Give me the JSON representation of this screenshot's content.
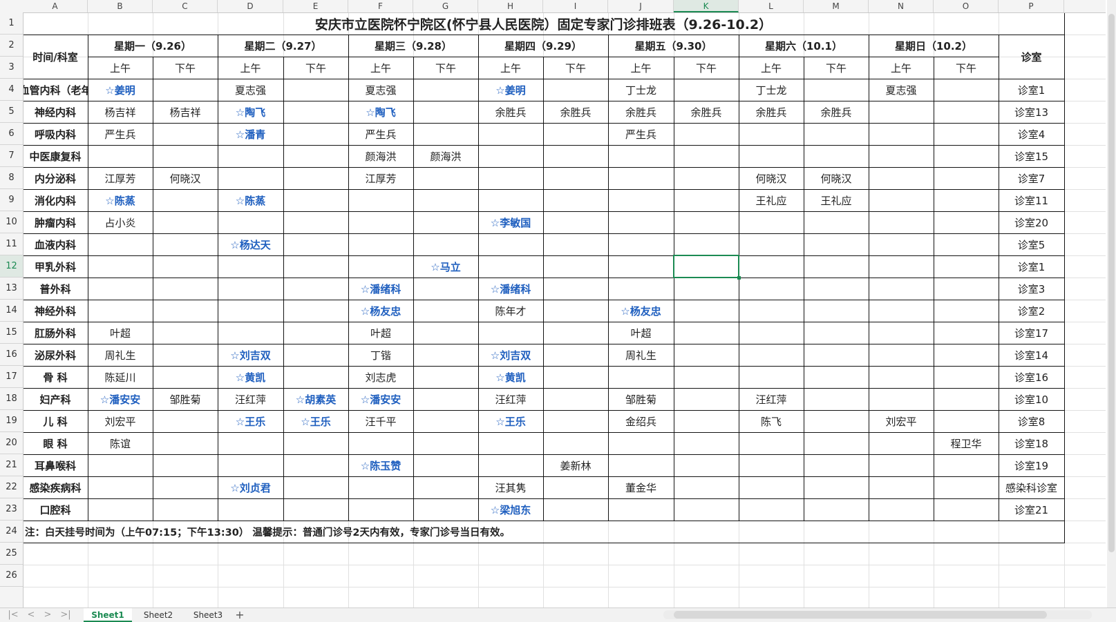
{
  "columns": [
    "A",
    "B",
    "C",
    "D",
    "E",
    "F",
    "G",
    "H",
    "I",
    "J",
    "K",
    "L",
    "M",
    "N",
    "O",
    "P"
  ],
  "selected_column": "K",
  "selected_row": 12,
  "rows": [
    1,
    2,
    3,
    4,
    5,
    6,
    7,
    8,
    9,
    10,
    11,
    12,
    13,
    14,
    15,
    16,
    17,
    18,
    19,
    20,
    21,
    22,
    23,
    24,
    25,
    26
  ],
  "title": "安庆市立医院怀宁院区(怀宁县人民医院）固定专家门诊排班表（9.26-10.2）",
  "header": {
    "time_dept": "时间/科室",
    "days": [
      "星期一（9.26）",
      "星期二（9.27）",
      "星期三（9.28）",
      "星期四（9.29）",
      "星期五（9.30）",
      "星期六（10.1）",
      "星期日（10.2）"
    ],
    "am": "上午",
    "pm": "下午",
    "room": "诊室"
  },
  "schedule": [
    {
      "dept": "心血管内科（老年病",
      "cells": [
        "☆姜明",
        "",
        "夏志强",
        "",
        "夏志强",
        "",
        "☆姜明",
        "",
        "丁士龙",
        "",
        "丁士龙",
        "",
        "夏志强",
        ""
      ],
      "room": "诊室1"
    },
    {
      "dept": "神经内科",
      "cells": [
        "杨吉祥",
        "杨吉祥",
        "☆陶飞",
        "",
        "☆陶飞",
        "",
        "余胜兵",
        "余胜兵",
        "余胜兵",
        "余胜兵",
        "余胜兵",
        "余胜兵",
        "",
        ""
      ],
      "room": "诊室13"
    },
    {
      "dept": "呼吸内科",
      "cells": [
        "严生兵",
        "",
        "☆潘青",
        "",
        "严生兵",
        "",
        "",
        "",
        "严生兵",
        "",
        "",
        "",
        "",
        ""
      ],
      "room": "诊室4"
    },
    {
      "dept": "中医康复科",
      "cells": [
        "",
        "",
        "",
        "",
        "颜海洪",
        "颜海洪",
        "",
        "",
        "",
        "",
        "",
        "",
        "",
        ""
      ],
      "room": "诊室15"
    },
    {
      "dept": "内分泌科",
      "cells": [
        "江厚芳",
        "何晓汉",
        "",
        "",
        "江厚芳",
        "",
        "",
        "",
        "",
        "",
        "何晓汉",
        "何晓汉",
        "",
        ""
      ],
      "room": "诊室7"
    },
    {
      "dept": "消化内科",
      "cells": [
        "☆陈蒸",
        "",
        "☆陈蒸",
        "",
        "",
        "",
        "",
        "",
        "",
        "",
        "王礼应",
        "王礼应",
        "",
        ""
      ],
      "room": "诊室11"
    },
    {
      "dept": "肿瘤内科",
      "cells": [
        "占小炎",
        "",
        "",
        "",
        "",
        "",
        "☆李敏国",
        "",
        "",
        "",
        "",
        "",
        "",
        ""
      ],
      "room": "诊室20"
    },
    {
      "dept": "血液内科",
      "cells": [
        "",
        "",
        "☆杨达天",
        "",
        "",
        "",
        "",
        "",
        "",
        "",
        "",
        "",
        "",
        ""
      ],
      "room": "诊室5"
    },
    {
      "dept": "甲乳外科",
      "cells": [
        "",
        "",
        "",
        "",
        "",
        "☆马立",
        "",
        "",
        "",
        "",
        "",
        "",
        "",
        ""
      ],
      "room": "诊室1"
    },
    {
      "dept": "普外科",
      "cells": [
        "",
        "",
        "",
        "",
        "☆潘绪科",
        "",
        "☆潘绪科",
        "",
        "",
        "",
        "",
        "",
        "",
        ""
      ],
      "room": "诊室3"
    },
    {
      "dept": "神经外科",
      "cells": [
        "",
        "",
        "",
        "",
        "☆杨友忠",
        "",
        "陈年才",
        "",
        "☆杨友忠",
        "",
        "",
        "",
        "",
        ""
      ],
      "room": "诊室2"
    },
    {
      "dept": "肛肠外科",
      "cells": [
        "叶超",
        "",
        "",
        "",
        "叶超",
        "",
        "",
        "",
        "叶超",
        "",
        "",
        "",
        "",
        ""
      ],
      "room": "诊室17"
    },
    {
      "dept": "泌尿外科",
      "cells": [
        "周礼生",
        "",
        "☆刘吉双",
        "",
        "丁锴",
        "",
        "☆刘吉双",
        "",
        "周礼生",
        "",
        "",
        "",
        "",
        ""
      ],
      "room": "诊室14"
    },
    {
      "dept": "骨  科",
      "cells": [
        "陈延川",
        "",
        "☆黄凯",
        "",
        "刘志虎",
        "",
        "☆黄凯",
        "",
        "",
        "",
        "",
        "",
        "",
        ""
      ],
      "room": "诊室16"
    },
    {
      "dept": "妇产科",
      "cells": [
        "☆潘安安",
        "邹胜菊",
        "汪红萍",
        "☆胡素英",
        "☆潘安安",
        "",
        "汪红萍",
        "",
        "邹胜菊",
        "",
        "汪红萍",
        "",
        "",
        ""
      ],
      "room": "诊室10"
    },
    {
      "dept": "儿  科",
      "cells": [
        "刘宏平",
        "",
        "☆王乐",
        "☆王乐",
        "汪千平",
        "",
        "☆王乐",
        "",
        "金绍兵",
        "",
        "陈飞",
        "",
        "刘宏平",
        ""
      ],
      "room": "诊室8"
    },
    {
      "dept": "眼  科",
      "cells": [
        "陈谊",
        "",
        "",
        "",
        "",
        "",
        "",
        "",
        "",
        "",
        "",
        "",
        "",
        "程卫华"
      ],
      "room": "诊室18"
    },
    {
      "dept": "耳鼻喉科",
      "cells": [
        "",
        "",
        "",
        "",
        "☆陈玉赞",
        "",
        "",
        "姜新林",
        "",
        "",
        "",
        "",
        "",
        ""
      ],
      "room": "诊室19"
    },
    {
      "dept": "感染疾病科",
      "cells": [
        "",
        "",
        "☆刘贞君",
        "",
        "",
        "",
        "汪其隽",
        "",
        "董金华",
        "",
        "",
        "",
        "",
        ""
      ],
      "room": "感染科诊室"
    },
    {
      "dept": "口腔科",
      "cells": [
        "",
        "",
        "",
        "",
        "",
        "",
        "☆梁旭东",
        "",
        "",
        "",
        "",
        "",
        "",
        ""
      ],
      "room": "诊室21"
    }
  ],
  "note": "注：白天挂号时间为（上午07:15；下午13:30）   温馨提示：普通门诊号2天内有效，专家门诊号当日有效。",
  "sheets": [
    "Sheet1",
    "Sheet2",
    "Sheet3"
  ],
  "active_sheet": "Sheet1",
  "nav_icons": [
    "first-sheet-icon",
    "prev-sheet-icon",
    "next-sheet-icon",
    "last-sheet-icon"
  ],
  "add_sheet_symbol": "+",
  "colors": {
    "accent": "#1b8a52",
    "star_text": "#1f5fbf"
  }
}
